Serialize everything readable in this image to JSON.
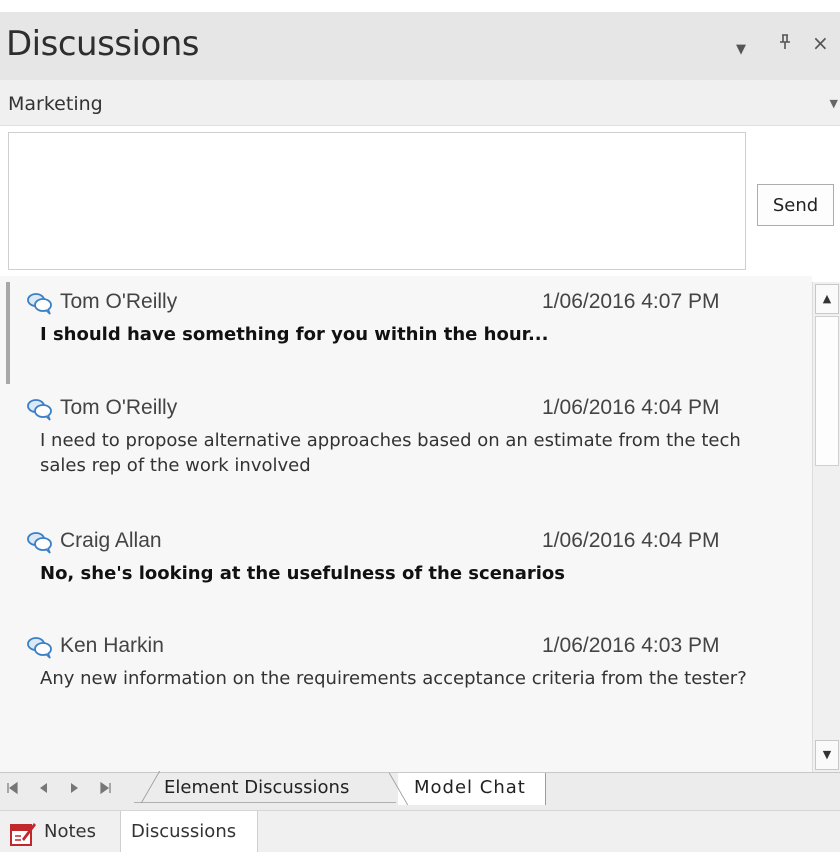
{
  "window": {
    "title": "Discussions",
    "controls": {
      "dropdown": "▼",
      "pin": "࿋",
      "close": "×"
    }
  },
  "channel": {
    "value": "Marketing",
    "arrow": "▼"
  },
  "composer": {
    "value": "",
    "send_label": "Send"
  },
  "messages": [
    {
      "author": "Tom O'Reilly",
      "timestamp": "1/06/2016 4:07 PM",
      "text": "I should have something for you within the hour...",
      "bold": true,
      "icon": "chat-bubbles-icon"
    },
    {
      "author": "Tom O'Reilly",
      "timestamp": "1/06/2016 4:04 PM",
      "text": "I need to propose alternative approaches based on an estimate from the tech sales rep of the work involved",
      "bold": false,
      "icon": "chat-bubbles-icon"
    },
    {
      "author": "Craig Allan",
      "timestamp": "1/06/2016 4:04 PM",
      "text": "No, she's looking at the usefulness of the scenarios",
      "bold": true,
      "icon": "chat-bubbles-icon"
    },
    {
      "author": "Ken Harkin",
      "timestamp": "1/06/2016 4:03 PM",
      "text": "Any new information on the requirements acceptance criteria from the tester?",
      "bold": false,
      "icon": "chat-bubbles-icon"
    }
  ],
  "scrollbar": {
    "up": "▲",
    "down": "▼"
  },
  "tab_nav": {
    "first": "⏮",
    "prev": "◀",
    "next": "▶",
    "last": "⏭"
  },
  "tabs": [
    {
      "label": "Element Discussions",
      "active": false
    },
    {
      "label": "Model Chat",
      "active": true
    }
  ],
  "bottom_tabs": [
    {
      "label": "Notes",
      "icon": "notes-icon",
      "active": false
    },
    {
      "label": "Discussions",
      "active": true
    }
  ],
  "colors": {
    "chat_icon": "#3a7fc6",
    "notes_icon": "#c0282c"
  }
}
